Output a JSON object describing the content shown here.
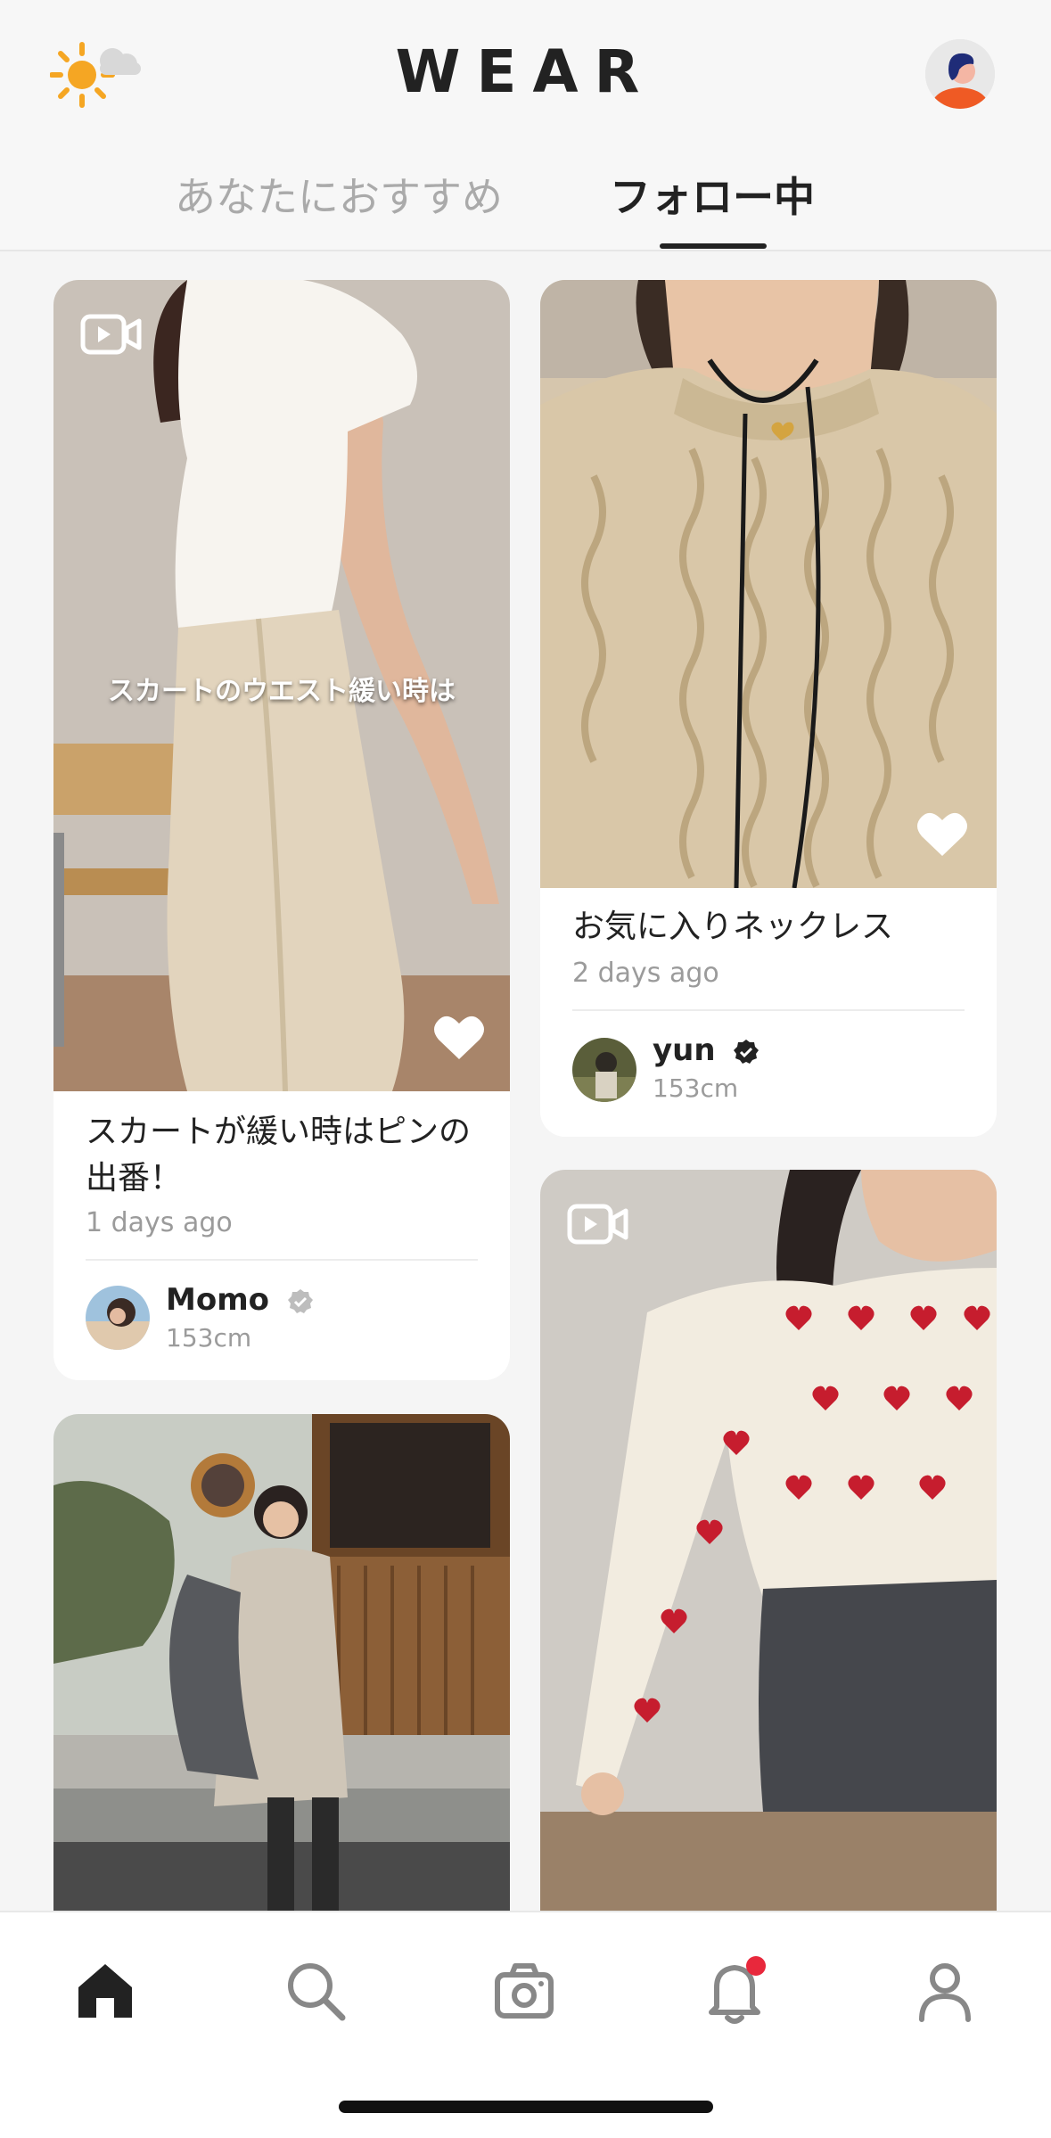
{
  "header": {
    "logo": "WEAR",
    "weather_icon": "sun-cloud-icon",
    "avatar_icon": "profile-avatar-icon"
  },
  "tabs": [
    {
      "label": "あなたにおすすめ",
      "active": false
    },
    {
      "label": "フォロー中",
      "active": true
    }
  ],
  "posts": [
    {
      "overlay_text": "スカートのウエスト緩い時は",
      "title": "スカートが緩い時はピンの出番！",
      "time": "1 days ago",
      "user": {
        "name": "Momo",
        "height": "153cm",
        "verified": false
      },
      "has_video": true,
      "liked": false
    },
    {
      "title": "お気に入りネックレス",
      "time": "2 days ago",
      "user": {
        "name": "yun",
        "height": "153cm",
        "verified": true
      },
      "has_video": false,
      "liked": false
    },
    {
      "has_video": true,
      "liked": false
    },
    {
      "has_video": false,
      "liked": false
    }
  ],
  "bottom_nav": [
    {
      "icon": "home-icon",
      "active": true
    },
    {
      "icon": "search-icon",
      "active": false
    },
    {
      "icon": "camera-icon",
      "active": false
    },
    {
      "icon": "bell-icon",
      "active": false,
      "badge_dot": true
    },
    {
      "icon": "profile-icon",
      "active": false
    }
  ],
  "colors": {
    "accent_red": "#e8283c",
    "text_dark": "#222222",
    "text_muted": "#9b9b9b",
    "verified_badge": "#222222",
    "unverified_badge": "#bdbdbd"
  }
}
